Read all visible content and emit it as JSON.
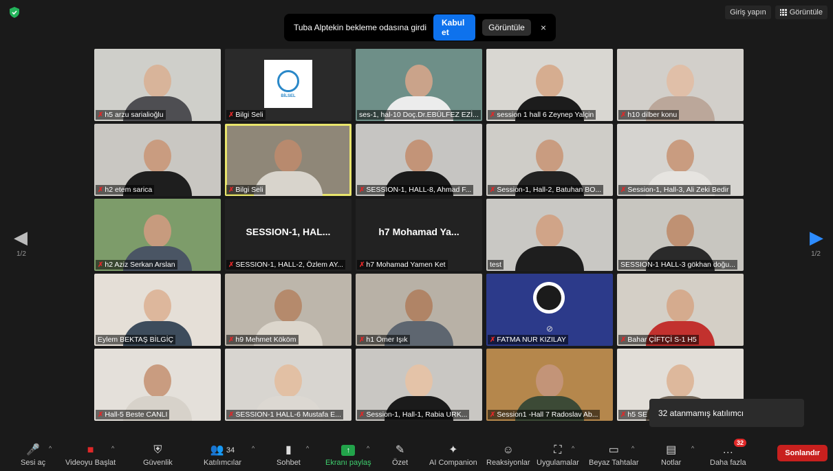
{
  "top": {
    "signin_label": "Giriş yapın",
    "view_label": "Görüntüle"
  },
  "notification": {
    "text": "Tuba Alptekin bekleme odasına girdi",
    "accept_label": "Kabul et",
    "view_label": "Görüntüle",
    "close_label": "×"
  },
  "tiles": [
    {
      "name": "h5 arzu sarialioğlu",
      "muted": true
    },
    {
      "name": "Bilgi Seli",
      "muted": true
    },
    {
      "name": "ses-1, hal-10 Doç.Dr.EBÜLFEZ EZİ...",
      "muted": false
    },
    {
      "name": "session 1 hall 6 Zeynep Yalçin",
      "muted": true
    },
    {
      "name": "h10 dilber konu",
      "muted": true
    },
    {
      "name": "h2 etem sarica",
      "muted": true
    },
    {
      "name": "Bilgi Seli",
      "muted": true
    },
    {
      "name": "SESSION-1, HALL-8, Ahmad F...",
      "muted": true
    },
    {
      "name": "Session-1, Hall-2, Batuhan BO...",
      "muted": true
    },
    {
      "name": "Session-1, Hall-3, Ali Zeki Bedir",
      "muted": true
    },
    {
      "name": "h2 Aziz Serkan Arslan",
      "muted": true
    },
    {
      "name": "SESSION-1, HALL-2, Özlem AY...",
      "muted": true,
      "center": "SESSION-1,  HAL..."
    },
    {
      "name": "h7 Mohamad Yamen Ket",
      "muted": true,
      "center": "h7  Mohamad  Ya..."
    },
    {
      "name": "test",
      "muted": false
    },
    {
      "name": "SESSION-1 HALL-3 gökhan doğu...",
      "muted": false
    },
    {
      "name": "Eylem BEKTAŞ BİLGİÇ",
      "muted": false
    },
    {
      "name": "h9 Mehmet Kököm",
      "muted": true
    },
    {
      "name": "h1 Ömer Işık",
      "muted": true
    },
    {
      "name": "FATMA NUR KIZILAY",
      "muted": true
    },
    {
      "name": "Bahar ÇİFTÇİ S-1 H5",
      "muted": true
    },
    {
      "name": "Hall-5 Beste CANLI",
      "muted": true
    },
    {
      "name": "SESSION-1 HALL-6 Mustafa E...",
      "muted": true
    },
    {
      "name": "Session-1, Hall-1, Rabia URK...",
      "muted": true
    },
    {
      "name": "Session1 -Hall 7 Radoslav Ab...",
      "muted": true
    },
    {
      "name": "h5 SE",
      "muted": true
    }
  ],
  "logo": {
    "text": "BİLSEL"
  },
  "pager": {
    "left": "1/2",
    "right": "1/2"
  },
  "tooltip": {
    "text": "32 atanmamış katılımcı"
  },
  "toolbar": {
    "unmute": "Sesi aç",
    "start_video": "Videoyu Başlat",
    "security": "Güvenlik",
    "participants": "Katılımcılar",
    "participants_count": "34",
    "chat": "Sohbet",
    "share": "Ekranı paylaş",
    "summary": "Özet",
    "ai": "AI Companion",
    "reactions": "Reaksiyonlar",
    "apps": "Uygulamalar",
    "whiteboards": "Beyaz Tahtalar",
    "notes": "Notlar",
    "more": "Daha fazla",
    "more_badge": "32",
    "end": "Sonlandır"
  }
}
